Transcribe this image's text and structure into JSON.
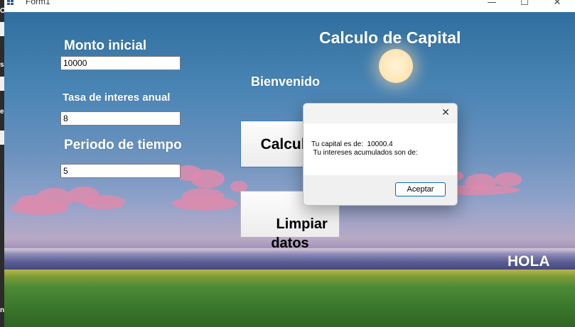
{
  "window": {
    "title": "Form1",
    "minimize_glyph": "—",
    "maximize_glyph": "☐",
    "close_glyph": "✕"
  },
  "behind_window": {
    "labels": [
      "C",
      "sa",
      "el",
      "n"
    ]
  },
  "form": {
    "heading": "Calculo de Capital",
    "welcome": "Bienvenido",
    "monto_label": "Monto inicial",
    "monto_value": "10000",
    "tasa_label": "Tasa de interes anual",
    "tasa_value": "8",
    "periodo_label": "Periodo de tiempo",
    "periodo_value": "5",
    "calcular_label": "Calcular",
    "limpiar_label": "Limpiar\ndatos",
    "hola": "HOLA"
  },
  "dialog": {
    "close_glyph": "✕",
    "message": "Tu capital es de:  10000.4\n Tu intereses acumulados son de:",
    "ok_label": "Aceptar"
  },
  "colors": {
    "sky_top": "#2f6f9f",
    "grass": "#3d7a2c",
    "accent": "#0067c0"
  }
}
